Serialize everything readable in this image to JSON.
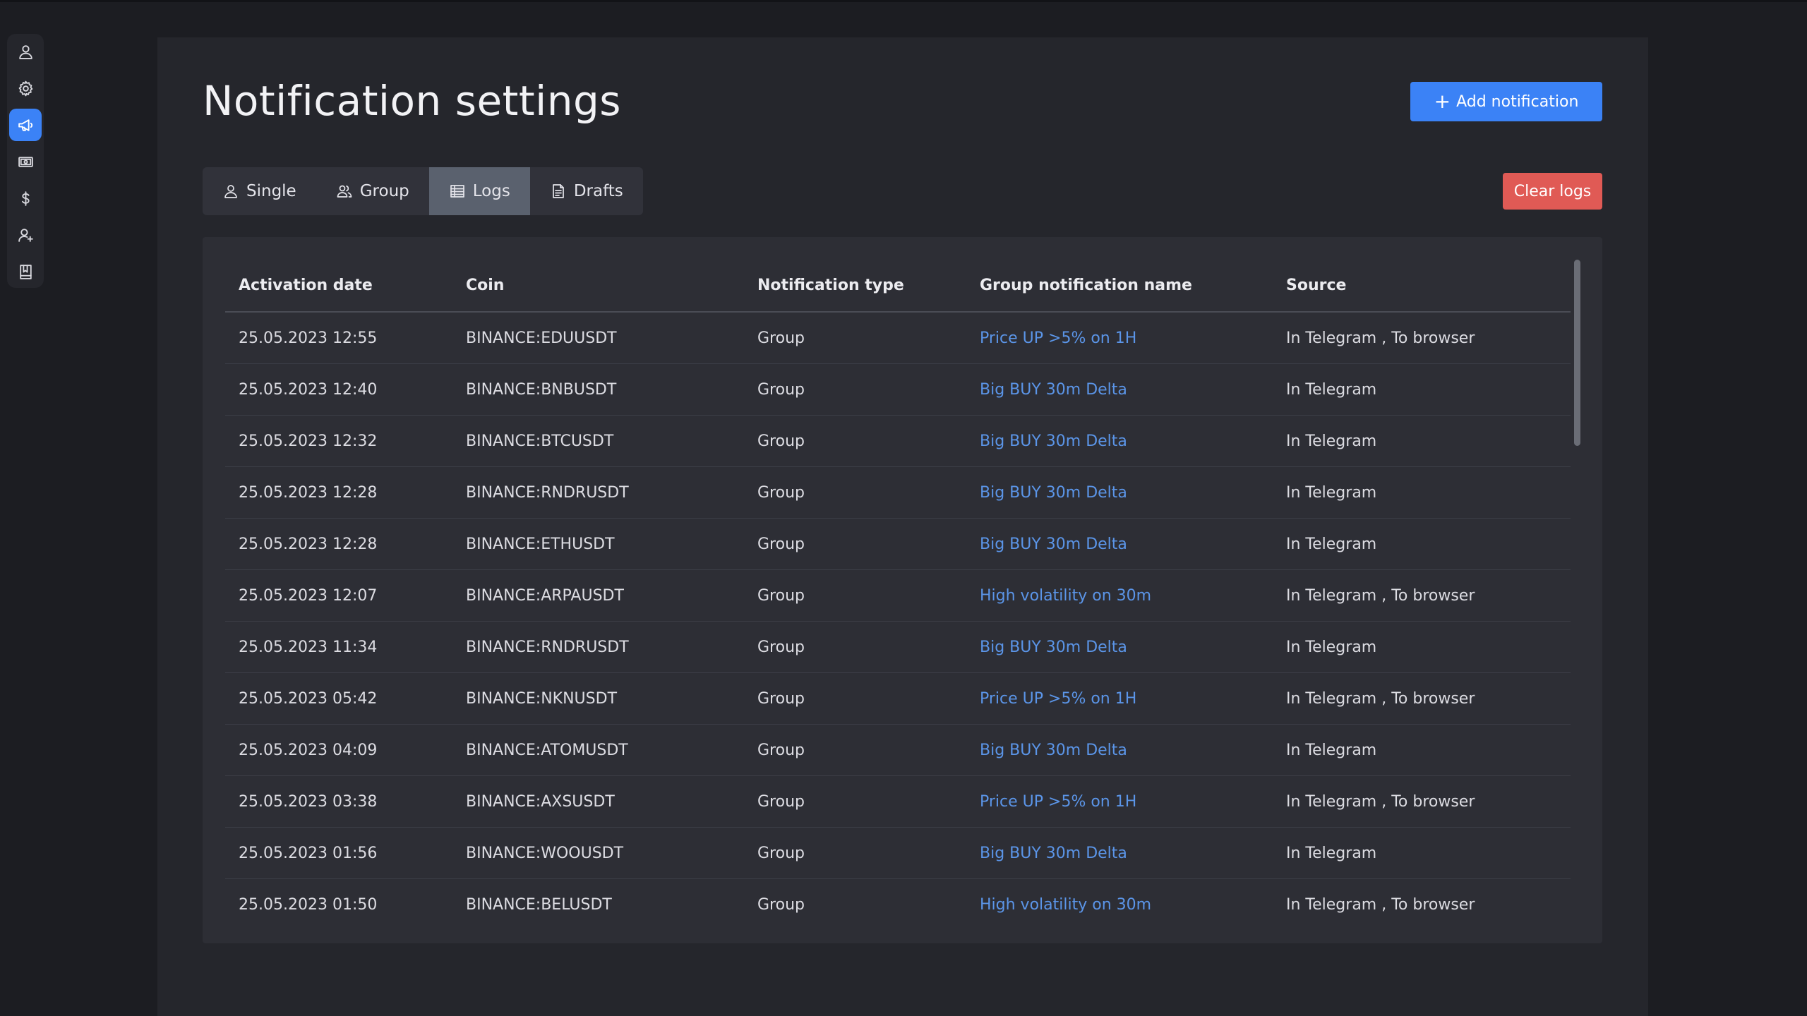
{
  "page": {
    "title": "Notification settings",
    "add_button": "Add notification",
    "clear_button": "Clear logs"
  },
  "sidebar": {
    "items": [
      {
        "icon": "user-icon",
        "active": false
      },
      {
        "icon": "gear-icon",
        "active": false
      },
      {
        "icon": "megaphone-icon",
        "active": true
      },
      {
        "icon": "banknote-icon",
        "active": false
      },
      {
        "icon": "dollar-icon",
        "active": false
      },
      {
        "icon": "user-plus-icon",
        "active": false
      },
      {
        "icon": "book-icon",
        "active": false
      }
    ]
  },
  "tabs": [
    {
      "label": "Single",
      "icon": "user-icon",
      "active": false
    },
    {
      "label": "Group",
      "icon": "users-icon",
      "active": false
    },
    {
      "label": "Logs",
      "icon": "table-icon",
      "active": true
    },
    {
      "label": "Drafts",
      "icon": "document-icon",
      "active": false
    }
  ],
  "table": {
    "headers": [
      "Activation date",
      "Coin",
      "Notification type",
      "Group notification name",
      "Source"
    ],
    "rows": [
      [
        "25.05.2023 12:55",
        "BINANCE:EDUUSDT",
        "Group",
        "Price UP >5% on 1H",
        "In Telegram , To browser"
      ],
      [
        "25.05.2023 12:40",
        "BINANCE:BNBUSDT",
        "Group",
        "Big BUY 30m Delta",
        "In Telegram"
      ],
      [
        "25.05.2023 12:32",
        "BINANCE:BTCUSDT",
        "Group",
        "Big BUY 30m Delta",
        "In Telegram"
      ],
      [
        "25.05.2023 12:28",
        "BINANCE:RNDRUSDT",
        "Group",
        "Big BUY 30m Delta",
        "In Telegram"
      ],
      [
        "25.05.2023 12:28",
        "BINANCE:ETHUSDT",
        "Group",
        "Big BUY 30m Delta",
        "In Telegram"
      ],
      [
        "25.05.2023 12:07",
        "BINANCE:ARPAUSDT",
        "Group",
        "High volatility on 30m",
        "In Telegram , To browser"
      ],
      [
        "25.05.2023 11:34",
        "BINANCE:RNDRUSDT",
        "Group",
        "Big BUY 30m Delta",
        "In Telegram"
      ],
      [
        "25.05.2023 05:42",
        "BINANCE:NKNUSDT",
        "Group",
        "Price UP >5% on 1H",
        "In Telegram , To browser"
      ],
      [
        "25.05.2023 04:09",
        "BINANCE:ATOMUSDT",
        "Group",
        "Big BUY 30m Delta",
        "In Telegram"
      ],
      [
        "25.05.2023 03:38",
        "BINANCE:AXSUSDT",
        "Group",
        "Price UP >5% on 1H",
        "In Telegram , To browser"
      ],
      [
        "25.05.2023 01:56",
        "BINANCE:WOOUSDT",
        "Group",
        "Big BUY 30m Delta",
        "In Telegram"
      ],
      [
        "25.05.2023 01:50",
        "BINANCE:BELUSDT",
        "Group",
        "High volatility on 30m",
        "In Telegram , To browser"
      ]
    ]
  },
  "colors": {
    "accent": "#3b82f6",
    "danger": "#e05a55",
    "link": "#5b95e8"
  }
}
